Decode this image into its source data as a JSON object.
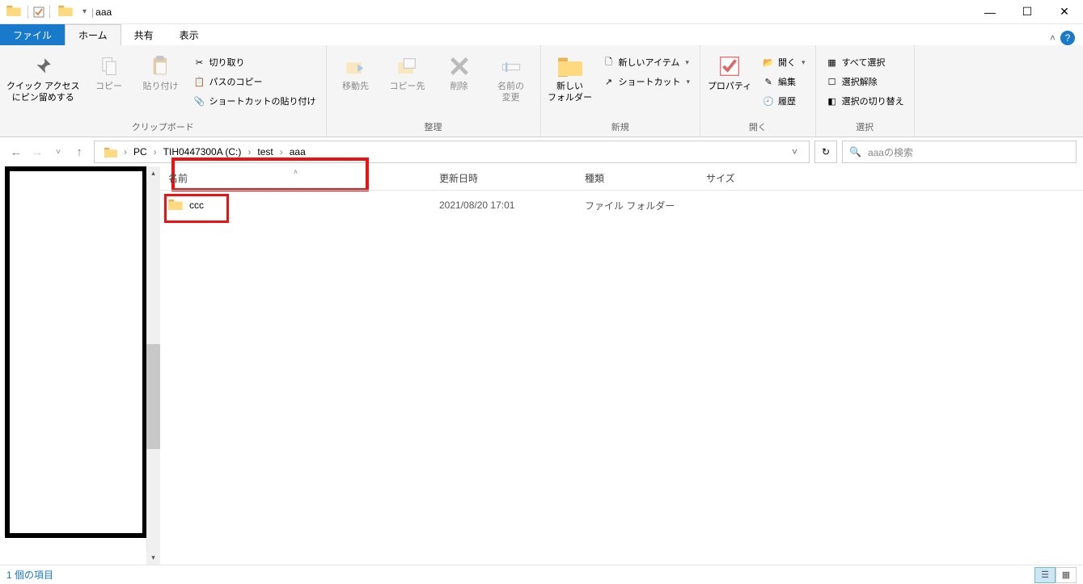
{
  "title": "aaa",
  "tabs": {
    "file": "ファイル",
    "home": "ホーム",
    "share": "共有",
    "view": "表示"
  },
  "ribbon": {
    "clipboard": {
      "label": "クリップボード",
      "pin": "クイック アクセス\nにピン留めする",
      "copy": "コピー",
      "paste": "貼り付け",
      "cut": "切り取り",
      "copypath": "パスのコピー",
      "pasteshortcut": "ショートカットの貼り付け"
    },
    "organize": {
      "label": "整理",
      "moveto": "移動先",
      "copyto": "コピー先",
      "delete": "削除",
      "rename": "名前の\n変更"
    },
    "new": {
      "label": "新規",
      "newfolder": "新しい\nフォルダー",
      "newitem": "新しいアイテム",
      "shortcut": "ショートカット"
    },
    "open": {
      "label": "開く",
      "properties": "プロパティ",
      "open": "開く",
      "edit": "編集",
      "history": "履歴"
    },
    "select": {
      "label": "選択",
      "selectall": "すべて選択",
      "selectnone": "選択解除",
      "invert": "選択の切り替え"
    }
  },
  "breadcrumb": {
    "pc": "PC",
    "drive": "TIH0447300A (C:)",
    "folder1": "test",
    "folder2": "aaa"
  },
  "search": {
    "placeholder": "aaaの検索"
  },
  "columns": {
    "name": "名前",
    "date": "更新日時",
    "type": "種類",
    "size": "サイズ"
  },
  "items": [
    {
      "name": "ccc",
      "date": "2021/08/20 17:01",
      "type": "ファイル フォルダー"
    }
  ],
  "status": {
    "text": "1 個の項目"
  }
}
